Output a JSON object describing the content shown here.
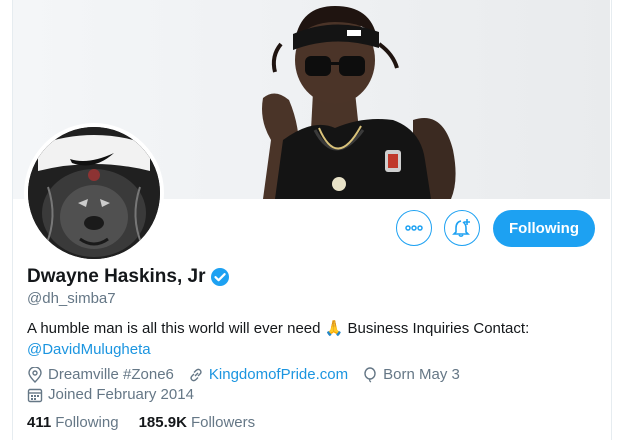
{
  "profile": {
    "name": "Dwayne Haskins, Jr",
    "handle": "@dh_simba7",
    "bio_text": "A humble man is all this world will ever need 🙏 Business Inquiries Contact:",
    "bio_mention": "@DavidMulugheta",
    "location": "Dreamville #Zone6",
    "website": "KingdomofPride.com",
    "birthday": "Born May 3",
    "joined": "Joined February 2014",
    "following_count": "411",
    "following_label": "Following",
    "followers_count": "185.9K",
    "followers_label": "Followers"
  },
  "actions": {
    "follow_label": "Following",
    "more_icon": "more-dots-icon",
    "notify_icon": "bell-plus-icon"
  },
  "colors": {
    "accent": "#1da1f2",
    "link": "#1b95e0",
    "secondary_text": "#657786",
    "primary_text": "#14171a"
  }
}
